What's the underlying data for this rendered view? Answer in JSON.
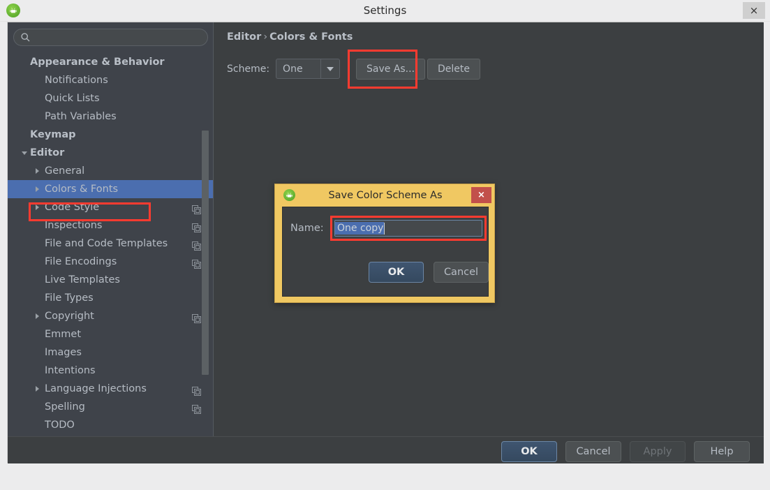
{
  "window": {
    "title": "Settings",
    "app_icon": "android-studio-icon",
    "close_label": "×"
  },
  "colors": {
    "sidebar_bg": "#3f434a",
    "panel_bg": "#3c3f41",
    "selection_blue": "#4b6eaf",
    "highlight_red": "#ff3b30",
    "dialog_gold": "#f0c862",
    "close_red": "#c2504b",
    "text": "#b6bcc4"
  },
  "search": {
    "value": "",
    "placeholder": "",
    "icon": "search-icon"
  },
  "sidebar": {
    "items": [
      {
        "label": "Appearance & Behavior",
        "depth": 0,
        "bold": true,
        "arrow": "none",
        "copy_icon": false,
        "selected": false
      },
      {
        "label": "Notifications",
        "depth": 1,
        "bold": false,
        "arrow": "none",
        "copy_icon": false,
        "selected": false
      },
      {
        "label": "Quick Lists",
        "depth": 1,
        "bold": false,
        "arrow": "none",
        "copy_icon": false,
        "selected": false
      },
      {
        "label": "Path Variables",
        "depth": 1,
        "bold": false,
        "arrow": "none",
        "copy_icon": false,
        "selected": false
      },
      {
        "label": "Keymap",
        "depth": 0,
        "bold": true,
        "arrow": "none",
        "copy_icon": false,
        "selected": false
      },
      {
        "label": "Editor",
        "depth": 0,
        "bold": true,
        "arrow": "down",
        "copy_icon": false,
        "selected": false
      },
      {
        "label": "General",
        "depth": 1,
        "bold": false,
        "arrow": "right",
        "copy_icon": false,
        "selected": false
      },
      {
        "label": "Colors & Fonts",
        "depth": 1,
        "bold": false,
        "arrow": "right",
        "copy_icon": false,
        "selected": true
      },
      {
        "label": "Code Style",
        "depth": 1,
        "bold": false,
        "arrow": "right",
        "copy_icon": true,
        "selected": false
      },
      {
        "label": "Inspections",
        "depth": 1,
        "bold": false,
        "arrow": "none",
        "copy_icon": true,
        "selected": false
      },
      {
        "label": "File and Code Templates",
        "depth": 1,
        "bold": false,
        "arrow": "none",
        "copy_icon": true,
        "selected": false
      },
      {
        "label": "File Encodings",
        "depth": 1,
        "bold": false,
        "arrow": "none",
        "copy_icon": true,
        "selected": false
      },
      {
        "label": "Live Templates",
        "depth": 1,
        "bold": false,
        "arrow": "none",
        "copy_icon": false,
        "selected": false
      },
      {
        "label": "File Types",
        "depth": 1,
        "bold": false,
        "arrow": "none",
        "copy_icon": false,
        "selected": false
      },
      {
        "label": "Copyright",
        "depth": 1,
        "bold": false,
        "arrow": "right",
        "copy_icon": true,
        "selected": false
      },
      {
        "label": "Emmet",
        "depth": 1,
        "bold": false,
        "arrow": "none",
        "copy_icon": false,
        "selected": false
      },
      {
        "label": "Images",
        "depth": 1,
        "bold": false,
        "arrow": "none",
        "copy_icon": false,
        "selected": false
      },
      {
        "label": "Intentions",
        "depth": 1,
        "bold": false,
        "arrow": "none",
        "copy_icon": false,
        "selected": false
      },
      {
        "label": "Language Injections",
        "depth": 1,
        "bold": false,
        "arrow": "right",
        "copy_icon": true,
        "selected": false
      },
      {
        "label": "Spelling",
        "depth": 1,
        "bold": false,
        "arrow": "none",
        "copy_icon": true,
        "selected": false
      },
      {
        "label": "TODO",
        "depth": 1,
        "bold": false,
        "arrow": "none",
        "copy_icon": false,
        "selected": false
      }
    ]
  },
  "main": {
    "breadcrumb": {
      "parent": "Editor",
      "separator": "›",
      "current": "Colors & Fonts"
    },
    "scheme": {
      "label": "Scheme:",
      "value": "One",
      "options": [
        "One"
      ]
    },
    "save_as_label": "Save As...",
    "delete_label": "Delete"
  },
  "bottom_bar": {
    "ok_label": "OK",
    "cancel_label": "Cancel",
    "apply_label": "Apply",
    "apply_disabled": true,
    "help_label": "Help"
  },
  "dialog": {
    "title": "Save Color Scheme As",
    "icon": "android-studio-icon",
    "close_label": "×",
    "name_label": "Name:",
    "name_value": "One copy",
    "name_selected": true,
    "ok_label": "OK",
    "cancel_label": "Cancel"
  }
}
